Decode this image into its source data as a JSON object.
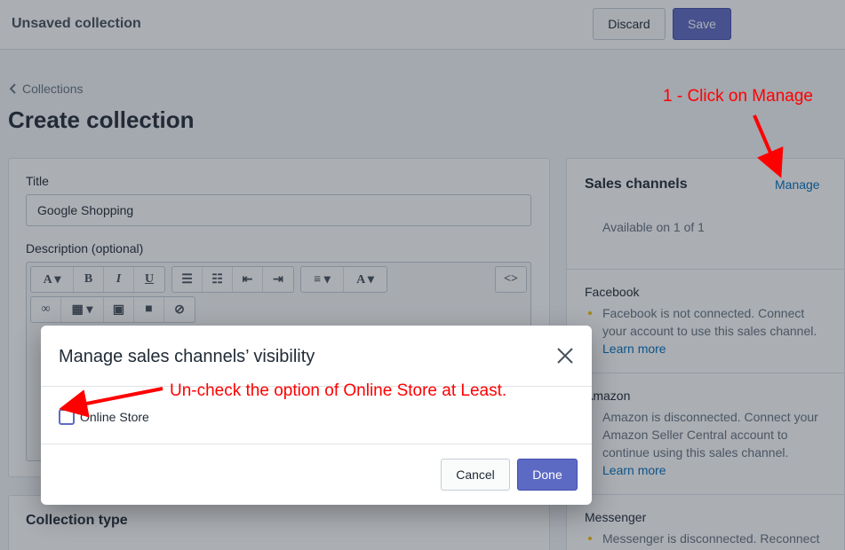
{
  "header": {
    "title": "Unsaved collection",
    "discard_label": "Discard",
    "save_label": "Save"
  },
  "breadcrumb": {
    "label": "Collections"
  },
  "page_title": "Create collection",
  "form": {
    "title_label": "Title",
    "title_value": "Google Shopping",
    "description_label": "Description (optional)"
  },
  "collection_type": {
    "title": "Collection type"
  },
  "sales_channels": {
    "title": "Sales channels",
    "manage_label": "Manage",
    "availability": "Available on 1 of 1",
    "channels": [
      {
        "name": "Facebook",
        "description": "Facebook is not connected. Connect your account to use this sales channel.",
        "link": "Learn more"
      },
      {
        "name": "Amazon",
        "description": "Amazon is disconnected. Connect your Amazon Seller Central account to continue using this sales channel.",
        "link": "Learn more"
      },
      {
        "name": "Messenger",
        "description": "Messenger is disconnected. Reconnect"
      }
    ]
  },
  "modal": {
    "title": "Manage sales channels’ visibility",
    "option_label": "Online Store",
    "option_checked": false,
    "cancel_label": "Cancel",
    "done_label": "Done"
  },
  "annotations": {
    "manage_hint": "1 - Click on Manage",
    "uncheck_hint": "Un-check the option of Online Store at Least."
  },
  "colors": {
    "primary": "#5c6ac4",
    "link": "#006fbb",
    "annotation": "#ff0000"
  }
}
